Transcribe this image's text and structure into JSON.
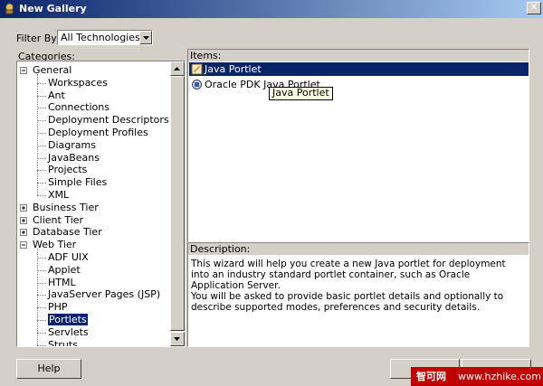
{
  "window": {
    "title": "New Gallery"
  },
  "filter": {
    "label": "Filter By:",
    "value": "All Technologies"
  },
  "categories": {
    "label": "Categories:",
    "items": [
      {
        "label": "General",
        "level": 0,
        "expander": "minus"
      },
      {
        "label": "Workspaces",
        "level": 1
      },
      {
        "label": "Ant",
        "level": 1
      },
      {
        "label": "Connections",
        "level": 1
      },
      {
        "label": "Deployment Descriptors",
        "level": 1
      },
      {
        "label": "Deployment Profiles",
        "level": 1
      },
      {
        "label": "Diagrams",
        "level": 1
      },
      {
        "label": "JavaBeans",
        "level": 1
      },
      {
        "label": "Projects",
        "level": 1
      },
      {
        "label": "Simple Files",
        "level": 1
      },
      {
        "label": "XML",
        "level": 1
      },
      {
        "label": "Business Tier",
        "level": 0,
        "expander": "plus"
      },
      {
        "label": "Client Tier",
        "level": 0,
        "expander": "plus"
      },
      {
        "label": "Database Tier",
        "level": 0,
        "expander": "plus"
      },
      {
        "label": "Web Tier",
        "level": 0,
        "expander": "minus"
      },
      {
        "label": "ADF UIX",
        "level": 1
      },
      {
        "label": "Applet",
        "level": 1
      },
      {
        "label": "HTML",
        "level": 1
      },
      {
        "label": "JavaServer Pages (JSP)",
        "level": 1
      },
      {
        "label": "PHP",
        "level": 1
      },
      {
        "label": "Portlets",
        "level": 1,
        "selected": true
      },
      {
        "label": "Servlets",
        "level": 1
      },
      {
        "label": "Struts",
        "level": 1
      }
    ]
  },
  "items": {
    "label": "Items:",
    "list": [
      {
        "label": "Java Portlet",
        "icon": "java-portlet-icon",
        "selected": true
      },
      {
        "label": "Oracle PDK Java Portlet",
        "icon": "oracle-pdk-portlet-icon",
        "selected": false
      }
    ],
    "tooltip": "Java Portlet"
  },
  "description": {
    "label": "Description:",
    "paragraph1": "This wizard will help you create a new Java portlet for deployment into an industry standard portlet container, such as Oracle Application Server.",
    "paragraph2": "You will be asked to provide basic portlet details and optionally to describe supported modes, preferences and security details."
  },
  "buttons": {
    "help": "Help",
    "ok": "",
    "cancel": ""
  },
  "watermark": {
    "brand": "智可网",
    "url": "www.hzhike.com"
  },
  "colors": {
    "selection": "#0a246a",
    "face": "#d4d0c8",
    "watermark": "#c00000"
  }
}
